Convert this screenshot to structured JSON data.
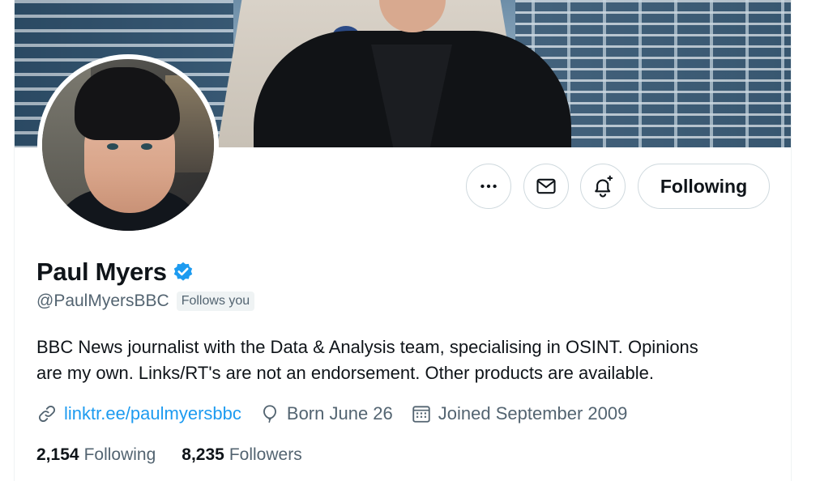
{
  "profile": {
    "display_name": "Paul Myers",
    "handle": "@PaulMyersBBC",
    "follows_you": "Follows you",
    "verified": true,
    "bio_line1": "BBC News journalist with the Data & Analysis team, specialising in OSINT. Opinions",
    "bio_line2": "are my own. Links/RT's are not an endorsement. Other products are available.",
    "link": "linktr.ee/paulmyersbbc",
    "birthday": "Born June 26",
    "joined": "Joined September 2009"
  },
  "actions": {
    "more_icon": "more-horizontal-icon",
    "message_icon": "envelope-icon",
    "notify_icon": "bell-plus-icon",
    "following_label": "Following"
  },
  "stats": {
    "following_count": "2,154",
    "following_label": "Following",
    "followers_count": "8,235",
    "followers_label": "Followers"
  },
  "colors": {
    "accent": "#1d9bf0",
    "secondary_text": "#536471",
    "primary_text": "#0f1419",
    "border": "#cfd9de"
  }
}
